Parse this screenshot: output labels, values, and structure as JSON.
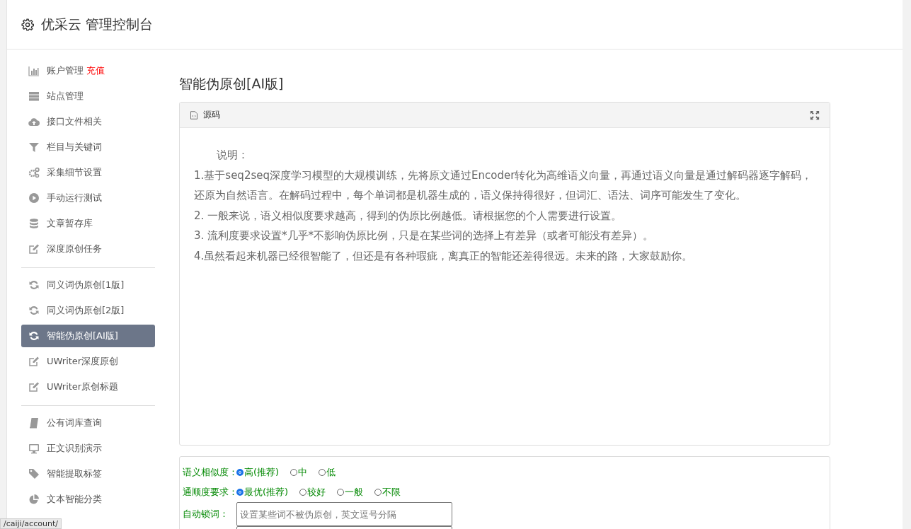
{
  "header": {
    "title": "优采云 管理控制台"
  },
  "sidebar": {
    "groups": [
      {
        "items": [
          {
            "label": "账户管理",
            "badge": "充值",
            "selected": false
          },
          {
            "label": "站点管理",
            "selected": false
          },
          {
            "label": "接口文件相关",
            "selected": false
          },
          {
            "label": "栏目与关键词",
            "selected": false
          },
          {
            "label": "采集细节设置",
            "selected": false
          },
          {
            "label": "手动运行测试",
            "selected": false
          },
          {
            "label": "文章暂存库",
            "selected": false
          },
          {
            "label": "深度原创任务",
            "selected": false
          }
        ]
      },
      {
        "items": [
          {
            "label": "同义词伪原创[1版]",
            "selected": false
          },
          {
            "label": "同义词伪原创[2版]",
            "selected": false
          },
          {
            "label": "智能伪原创[AI版]",
            "selected": true
          },
          {
            "label": "UWriter深度原创",
            "selected": false
          },
          {
            "label": "UWriter原创标题",
            "selected": false
          }
        ]
      },
      {
        "items": [
          {
            "label": "公有词库查询",
            "selected": false
          },
          {
            "label": "正文识别演示",
            "selected": false
          },
          {
            "label": "智能提取标签",
            "selected": false
          },
          {
            "label": "文本智能分类",
            "selected": false
          }
        ]
      }
    ]
  },
  "main": {
    "title": "智能伪原创[AI版]",
    "editor": {
      "tab": "源码",
      "lines": [
        "说明：",
        "1.基于seq2seq深度学习模型的大规模训练，先将原文通过Encoder转化为高维语义向量，再通过语义向量是通过解码器逐字解码，还原为自然语言。在解码过程中，每个单词都是机器生成的，语义保持得很好，但词汇、语法、词序可能发生了变化。",
        "2. 一般来说，语义相似度要求越高，得到的伪原比例越低。请根据您的个人需要进行设置。",
        "3. 流利度要求设置*几乎*不影响伪原比例，只是在某些词的选择上有差异（或者可能没有差异）。",
        "4.虽然看起来机器已经很智能了，但还是有各种瑕疵，离真正的智能还差得很远。未来的路，大家鼓励你。"
      ]
    },
    "form": {
      "rows": [
        {
          "kind": "radio",
          "label": "语义相似度：",
          "options": [
            {
              "label": "高(推荐)",
              "selected": true
            },
            {
              "label": "中",
              "selected": false
            },
            {
              "label": "低",
              "selected": false
            }
          ]
        },
        {
          "kind": "radio",
          "label": "通顺度要求：",
          "options": [
            {
              "label": "最优(推荐)",
              "selected": true
            },
            {
              "label": "较好",
              "selected": false
            },
            {
              "label": "一般",
              "selected": false
            },
            {
              "label": "不限",
              "selected": false
            }
          ]
        },
        {
          "kind": "input",
          "label": "自动锁词：",
          "placeholder": "设置某些词不被伪原创，英文逗号分隔"
        },
        {
          "kind": "input"
        }
      ]
    }
  },
  "status_bar": {
    "url": "/caiji/account/"
  }
}
